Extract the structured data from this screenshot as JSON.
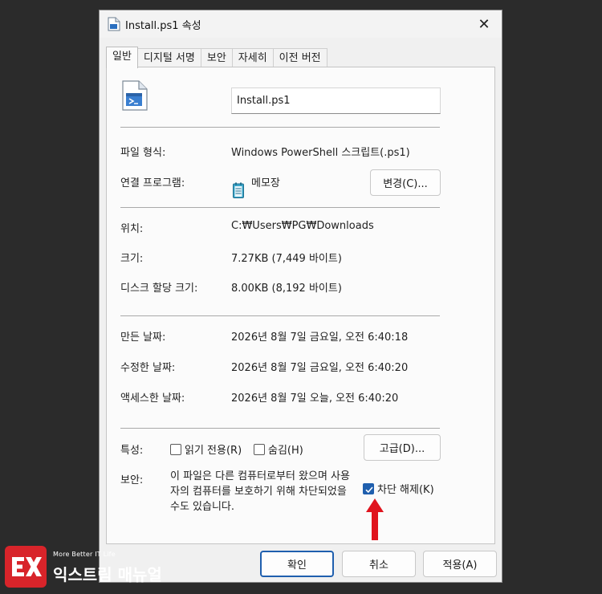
{
  "window": {
    "title": "Install.ps1 속성",
    "close_glyph": "✕"
  },
  "tabs": [
    {
      "label": "일반",
      "active": true
    },
    {
      "label": "디지털 서명"
    },
    {
      "label": "보안"
    },
    {
      "label": "자세히"
    },
    {
      "label": "이전 버전"
    }
  ],
  "general": {
    "filename": "Install.ps1",
    "file_type_label": "파일 형식:",
    "file_type_value": "Windows PowerShell 스크립트(.ps1)",
    "open_with_label": "연결 프로그램:",
    "open_with_value": "메모장",
    "change_button": "변경(C)...",
    "location_label": "위치:",
    "location_value": "C:₩Users₩PG₩Downloads",
    "size_label": "크기:",
    "size_value": "7.27KB (7,449 바이트)",
    "disk_size_label": "디스크 할당 크기:",
    "disk_size_value": "8.00KB (8,192 바이트)",
    "created_label": "만든 날짜:",
    "created_value": "2026년 8월 7일 금요일, 오전 6:40:18",
    "modified_label": "수정한 날짜:",
    "modified_value": "2026년 8월 7일 금요일, 오전 6:40:20",
    "accessed_label": "액세스한 날짜:",
    "accessed_value": "2026년 8월 7일 오늘, 오전 6:40:20",
    "attributes_label": "특성:",
    "readonly_label": "읽기 전용(R)",
    "hidden_label": "숨김(H)",
    "advanced_button": "고급(D)...",
    "security_label": "보안:",
    "security_text": "이 파일은 다른 컴퓨터로부터 왔으며 사용자의 컴퓨터를 보호하기 위해 차단되었을 수도 있습니다.",
    "unblock_label": "차단 해제(K)",
    "unblock_checked": true
  },
  "footer": {
    "ok_button": "확인",
    "cancel_button": "취소",
    "apply_button": "적용(A)"
  },
  "watermark": {
    "tagline": "More Better IT Life",
    "brand": "익스트림 매뉴얼",
    "logo_letter": "EX"
  },
  "colors": {
    "accent": "#1f5fae",
    "arrow": "#e0141e",
    "brand_red": "#d8242a"
  }
}
